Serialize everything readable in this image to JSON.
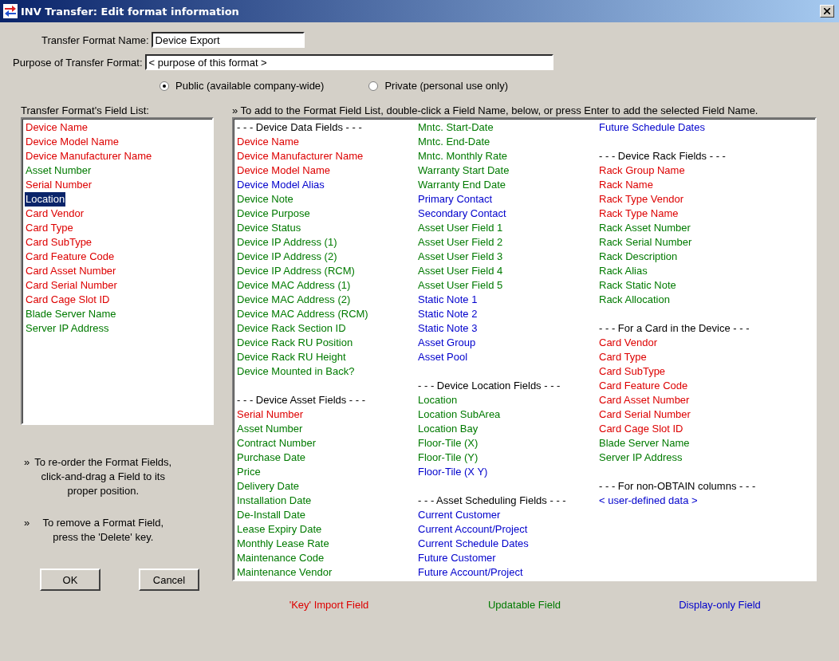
{
  "window": {
    "title": "INV Transfer: Edit format information"
  },
  "format_name": {
    "label": "Transfer Format Name:",
    "value": "Device Export"
  },
  "purpose": {
    "label": "Purpose of Transfer Format:",
    "value": "< purpose of this format >"
  },
  "visibility": [
    {
      "label": "Public (available company-wide)",
      "selected": true
    },
    {
      "label": "Private (personal use only)",
      "selected": false
    }
  ],
  "field_list": {
    "label": "Transfer Format's Field List:",
    "items": [
      {
        "label": "Device Name",
        "kind": "key",
        "selected": false
      },
      {
        "label": "Device Model Name",
        "kind": "key",
        "selected": false
      },
      {
        "label": "Device Manufacturer Name",
        "kind": "key",
        "selected": false
      },
      {
        "label": "Asset Number",
        "kind": "update",
        "selected": false
      },
      {
        "label": "Serial Number",
        "kind": "key",
        "selected": false
      },
      {
        "label": "Location",
        "kind": "update",
        "selected": true
      },
      {
        "label": "Card Vendor",
        "kind": "key",
        "selected": false
      },
      {
        "label": "Card Type",
        "kind": "key",
        "selected": false
      },
      {
        "label": "Card SubType",
        "kind": "key",
        "selected": false
      },
      {
        "label": "Card Feature Code",
        "kind": "key",
        "selected": false
      },
      {
        "label": "Card Asset Number",
        "kind": "key",
        "selected": false
      },
      {
        "label": "Card Serial Number",
        "kind": "key",
        "selected": false
      },
      {
        "label": "Card Cage Slot ID",
        "kind": "key",
        "selected": false
      },
      {
        "label": "Blade Server Name",
        "kind": "update",
        "selected": false
      },
      {
        "label": "Server IP Address",
        "kind": "update",
        "selected": false
      }
    ]
  },
  "hints": [
    "To re-order the Format Fields, click-and-drag a Field to its proper position.",
    "To remove a Format Field, press the 'Delete' key."
  ],
  "hint_marker": "»",
  "buttons": [
    "OK",
    "Cancel"
  ],
  "available_fields": {
    "instruction": "To add to the Format Field List, double-click a Field Name, below, or press Enter to add the selected Field Name.",
    "columns": [
      [
        {
          "label": "- - -  Device Data Fields  - - -",
          "kind": "heading"
        },
        {
          "label": "Device Name",
          "kind": "key"
        },
        {
          "label": "Device Manufacturer Name",
          "kind": "key"
        },
        {
          "label": "Device Model Name",
          "kind": "key"
        },
        {
          "label": "Device Model Alias",
          "kind": "display"
        },
        {
          "label": "Device Note",
          "kind": "update"
        },
        {
          "label": "Device Purpose",
          "kind": "update"
        },
        {
          "label": "Device Status",
          "kind": "update"
        },
        {
          "label": "Device IP Address (1)",
          "kind": "update"
        },
        {
          "label": "Device IP Address (2)",
          "kind": "update"
        },
        {
          "label": "Device IP Address (RCM)",
          "kind": "update"
        },
        {
          "label": "Device MAC Address (1)",
          "kind": "update"
        },
        {
          "label": "Device MAC Address (2)",
          "kind": "update"
        },
        {
          "label": "Device MAC Address (RCM)",
          "kind": "update"
        },
        {
          "label": "Device Rack Section ID",
          "kind": "update"
        },
        {
          "label": "Device Rack RU Position",
          "kind": "update"
        },
        {
          "label": "Device Rack RU Height",
          "kind": "update"
        },
        {
          "label": "Device Mounted in Back?",
          "kind": "update"
        },
        {
          "label": "- - -  Device Asset Fields  - - -",
          "kind": "heading"
        },
        {
          "label": "Serial Number",
          "kind": "key"
        },
        {
          "label": "Asset Number",
          "kind": "update"
        },
        {
          "label": "Contract Number",
          "kind": "update"
        },
        {
          "label": "Purchase Date",
          "kind": "update"
        },
        {
          "label": "Price",
          "kind": "update"
        },
        {
          "label": "Delivery Date",
          "kind": "update"
        },
        {
          "label": "Installation Date",
          "kind": "update"
        },
        {
          "label": "De-Install Date",
          "kind": "update"
        },
        {
          "label": "Lease Expiry Date",
          "kind": "update"
        },
        {
          "label": "Monthly Lease Rate",
          "kind": "update"
        },
        {
          "label": "Maintenance Code",
          "kind": "update"
        },
        {
          "label": "Maintenance Vendor",
          "kind": "update"
        }
      ],
      [
        {
          "label": "Mntc. Start-Date",
          "kind": "update"
        },
        {
          "label": "Mntc. End-Date",
          "kind": "update"
        },
        {
          "label": "Mntc. Monthly Rate",
          "kind": "update"
        },
        {
          "label": "Warranty Start Date",
          "kind": "update"
        },
        {
          "label": "Warranty End Date",
          "kind": "update"
        },
        {
          "label": "Primary Contact",
          "kind": "display"
        },
        {
          "label": "Secondary Contact",
          "kind": "display"
        },
        {
          "label": "Asset User Field 1",
          "kind": "update"
        },
        {
          "label": "Asset User Field 2",
          "kind": "update"
        },
        {
          "label": "Asset User Field 3",
          "kind": "update"
        },
        {
          "label": "Asset User Field 4",
          "kind": "update"
        },
        {
          "label": "Asset User Field 5",
          "kind": "update"
        },
        {
          "label": "Static Note 1",
          "kind": "display"
        },
        {
          "label": "Static Note 2",
          "kind": "display"
        },
        {
          "label": "Static Note 3",
          "kind": "display"
        },
        {
          "label": "Asset Group",
          "kind": "display"
        },
        {
          "label": "Asset Pool",
          "kind": "display"
        },
        {
          "label": "- - -  Device Location Fields  - - -",
          "kind": "heading"
        },
        {
          "label": "Location",
          "kind": "update"
        },
        {
          "label": "Location SubArea",
          "kind": "update"
        },
        {
          "label": "Location Bay",
          "kind": "update"
        },
        {
          "label": "Floor-Tile (X)",
          "kind": "update"
        },
        {
          "label": "Floor-Tile (Y)",
          "kind": "update"
        },
        {
          "label": "Floor-Tile (X Y)",
          "kind": "display"
        },
        {
          "label": "- - -  Asset Scheduling Fields  - - -",
          "kind": "heading"
        },
        {
          "label": "Current Customer",
          "kind": "display"
        },
        {
          "label": "Current Account/Project",
          "kind": "display"
        },
        {
          "label": "Current Schedule Dates",
          "kind": "display"
        },
        {
          "label": "Future Customer",
          "kind": "display"
        },
        {
          "label": "Future Account/Project",
          "kind": "display"
        }
      ],
      [
        {
          "label": "Future Schedule Dates",
          "kind": "display"
        },
        {
          "label": "- - -  Device Rack Fields  - - -",
          "kind": "heading"
        },
        {
          "label": "Rack Group Name",
          "kind": "key"
        },
        {
          "label": "Rack Name",
          "kind": "key"
        },
        {
          "label": "Rack Type Vendor",
          "kind": "key"
        },
        {
          "label": "Rack Type Name",
          "kind": "key"
        },
        {
          "label": "Rack Asset Number",
          "kind": "update"
        },
        {
          "label": "Rack Serial Number",
          "kind": "update"
        },
        {
          "label": "Rack Description",
          "kind": "update"
        },
        {
          "label": "Rack Alias",
          "kind": "update"
        },
        {
          "label": "Rack Static Note",
          "kind": "update"
        },
        {
          "label": "Rack Allocation",
          "kind": "update"
        },
        {
          "label": "- - -  For a Card in the Device  - - -",
          "kind": "heading"
        },
        {
          "label": "Card Vendor",
          "kind": "key"
        },
        {
          "label": "Card Type",
          "kind": "key"
        },
        {
          "label": "Card SubType",
          "kind": "key"
        },
        {
          "label": "Card Feature Code",
          "kind": "key"
        },
        {
          "label": "Card Asset Number",
          "kind": "key"
        },
        {
          "label": "Card Serial Number",
          "kind": "key"
        },
        {
          "label": "Card Cage Slot ID",
          "kind": "key"
        },
        {
          "label": "Blade Server Name",
          "kind": "update"
        },
        {
          "label": "Server IP Address",
          "kind": "update"
        },
        {
          "label": "- - -  For non-OBTAIN columns  - - -",
          "kind": "heading"
        },
        {
          "label": "< user-defined data >",
          "kind": "display"
        }
      ]
    ]
  },
  "legend": [
    {
      "label": "'Key' Import Field",
      "kind": "key"
    },
    {
      "label": "Updatable Field",
      "kind": "update"
    },
    {
      "label": "Display-only Field",
      "kind": "display"
    }
  ]
}
